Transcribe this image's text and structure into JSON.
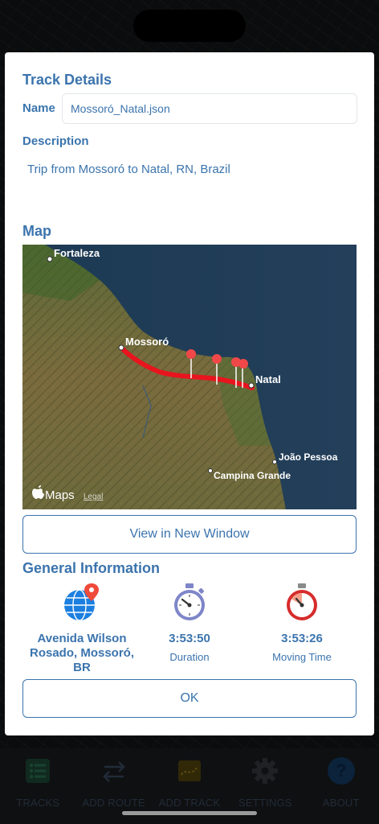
{
  "modal": {
    "title": "Track Details",
    "name_label": "Name",
    "name_value": "Mossoró_Natal.json",
    "description_label": "Description",
    "description_value": "Trip from Mossoró to Natal, RN, Brazil",
    "map_title": "Map",
    "map": {
      "cities": [
        "Fortaleza",
        "Mossoró",
        "Natal",
        "João Pessoa",
        "Campina Grande"
      ],
      "attribution": "Maps",
      "legal": "Legal",
      "route_color": "#e8141e",
      "pin_color": "#f04848"
    },
    "view_button": "View in New Window",
    "general_title": "General Information",
    "info": [
      {
        "icon": "globe-pin-icon",
        "value": "Avenida Wilson Rosado, Mossoró, BR",
        "label": ""
      },
      {
        "icon": "stopwatch-icon",
        "value": "3:53:50",
        "label": "Duration"
      },
      {
        "icon": "timer-icon",
        "value": "3:53:26",
        "label": "Moving Time"
      }
    ],
    "ok_button": "OK"
  },
  "tabbar": {
    "items": [
      {
        "label": "TRACKS",
        "icon": "list-icon"
      },
      {
        "label": "ADD ROUTE",
        "icon": "arrows-icon"
      },
      {
        "label": "ADD TRACK",
        "icon": "track-icon"
      },
      {
        "label": "SETTINGS",
        "icon": "gear-icon"
      },
      {
        "label": "ABOUT",
        "icon": "question-icon"
      }
    ]
  },
  "colors": {
    "accent": "#3b74ad",
    "tab_inactive": "#3c4f66"
  }
}
